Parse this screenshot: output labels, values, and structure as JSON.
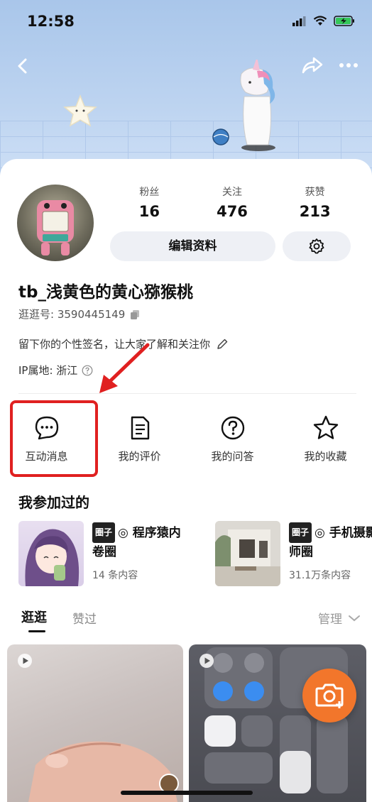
{
  "status_bar": {
    "time": "12:58",
    "icons": [
      "signal-icon",
      "wifi-icon",
      "battery-charging-icon"
    ]
  },
  "nav": {
    "icons": [
      "back-icon",
      "share-icon",
      "more-icon"
    ]
  },
  "profile": {
    "stats": [
      {
        "label": "粉丝",
        "value": "16"
      },
      {
        "label": "关注",
        "value": "476"
      },
      {
        "label": "获赞",
        "value": "213"
      }
    ],
    "edit_label": "编辑资料",
    "username": "tb_浅黄色的黄心猕猴桃",
    "id_text": "逛逛号: 3590445149",
    "signature": "留下你的个性签名，让大家了解和关注你",
    "ip_text": "IP属地: 浙江"
  },
  "actions": [
    {
      "label": "互动消息",
      "icon": "chat-bubble-icon"
    },
    {
      "label": "我的评价",
      "icon": "document-icon"
    },
    {
      "label": "我的问答",
      "icon": "question-icon"
    },
    {
      "label": "我的收藏",
      "icon": "star-icon"
    }
  ],
  "circles": {
    "title": "我参加过的",
    "items": [
      {
        "tag": "圈子",
        "name": "◎ 程序猿内卷圈",
        "count": "14 条内容"
      },
      {
        "tag": "圈子",
        "name": "◎ 手机摄影师圈",
        "count": "31.1万条内容"
      }
    ]
  },
  "tabs": {
    "active": "逛逛",
    "other": "赞过",
    "manage": "管理"
  },
  "colors": {
    "accent": "#f2762b",
    "highlight": "#e02020",
    "hero_bg": "#b5cdee"
  }
}
